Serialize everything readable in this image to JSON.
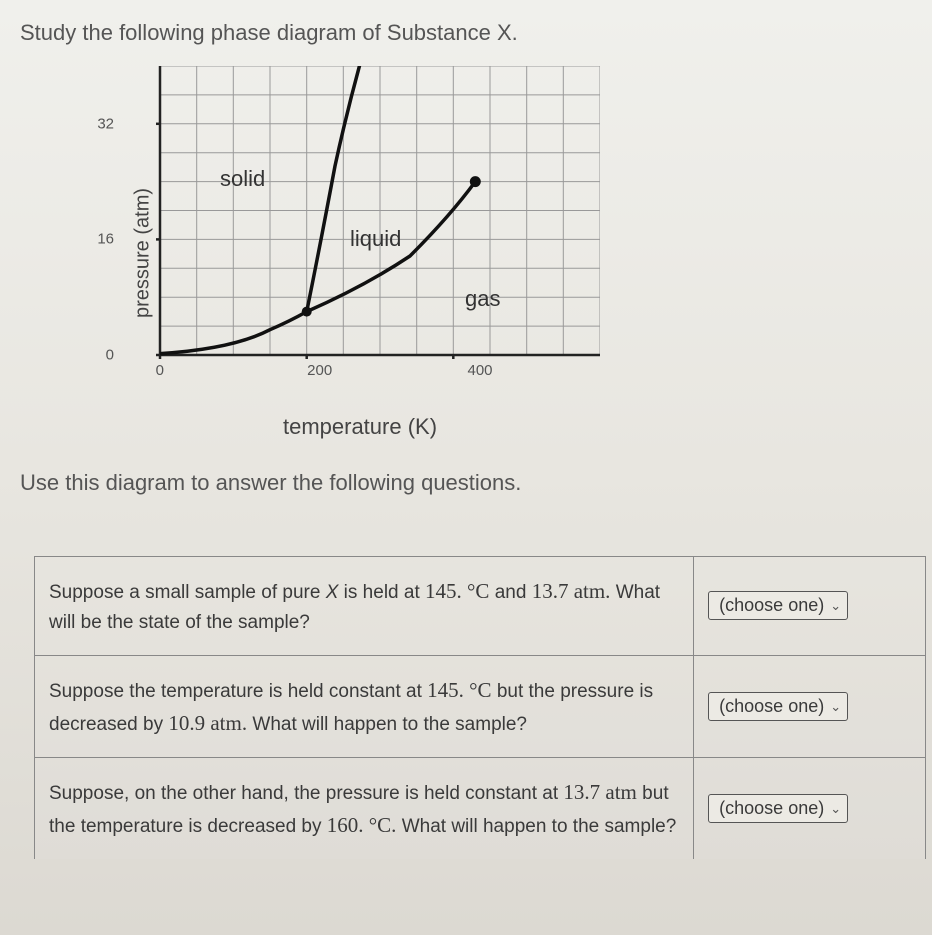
{
  "title": "Study the following phase diagram of Substance X.",
  "instruction": "Use this diagram to answer the following questions.",
  "chart_data": {
    "type": "line",
    "xlabel": "temperature (K)",
    "ylabel": "pressure (atm)",
    "xlim": [
      0,
      600
    ],
    "ylim": [
      0,
      40
    ],
    "xticks": [
      0,
      200,
      400
    ],
    "yticks": [
      0,
      16,
      32
    ],
    "grid": true,
    "regions": [
      {
        "label": "solid",
        "x": 120,
        "y": 24
      },
      {
        "label": "liquid",
        "x": 280,
        "y": 16
      },
      {
        "label": "gas",
        "x": 430,
        "y": 7
      }
    ],
    "series": [
      {
        "name": "solid-gas-boundary",
        "x": [
          0,
          50,
          100,
          150,
          200
        ],
        "y": [
          0.2,
          0.7,
          1.8,
          3.5,
          6
        ]
      },
      {
        "name": "liquid-gas-boundary",
        "x": [
          200,
          260,
          320,
          380,
          430
        ],
        "y": [
          6,
          8,
          11,
          16,
          24
        ]
      },
      {
        "name": "solid-liquid-boundary",
        "x": [
          200,
          220,
          240,
          260,
          280
        ],
        "y": [
          6,
          16,
          26,
          36,
          46
        ]
      }
    ],
    "points": {
      "triple_point": {
        "x": 200,
        "y": 6
      },
      "critical_point": {
        "x": 430,
        "y": 24
      }
    }
  },
  "questions": [
    {
      "prefix": "Suppose a small sample of pure ",
      "var": "X",
      "mid1": " is held at ",
      "val1": "145. °C",
      "mid2": " and ",
      "val2": "13.7 atm.",
      "suffix": " What will be the state of the sample?",
      "select": "(choose one)"
    },
    {
      "prefix": "Suppose the temperature is held constant at ",
      "val1": "145. °C",
      "mid1": " but the pressure is decreased by ",
      "val2": "10.9 atm.",
      "suffix": " What will happen to the sample?",
      "select": "(choose one)"
    },
    {
      "prefix": "Suppose, on the other hand, the pressure is held constant at ",
      "val1": "13.7 atm",
      "mid1": " but the temperature is decreased by ",
      "val2": "160. °C.",
      "suffix": " What will happen to the sample?",
      "select": "(choose one)"
    }
  ]
}
